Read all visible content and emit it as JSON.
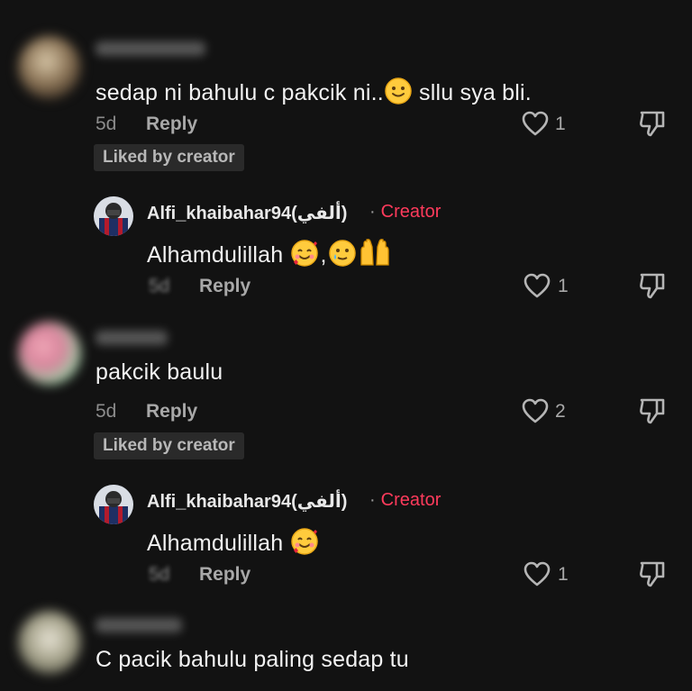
{
  "comments": [
    {
      "text": "sedap ni bahulu c pakcik ni..",
      "text_after_emoji": " sllu sya bli.",
      "age": "5d",
      "reply_label": "Reply",
      "likes": "1",
      "badge": "Liked by creator"
    },
    {
      "username": "Alfi_khaibahar94(ألفي)",
      "separator": "·",
      "creator_label": "Creator",
      "text": "Alhamdulillah",
      "text_between": ",",
      "age": "5d",
      "reply_label": "Reply",
      "likes": "1"
    },
    {
      "text": "pakcik baulu",
      "age": "5d",
      "reply_label": "Reply",
      "likes": "2",
      "badge": "Liked by creator"
    },
    {
      "username": "Alfi_khaibahar94(ألفي)",
      "separator": "·",
      "creator_label": "Creator",
      "text": "Alhamdulillah",
      "age": "5d",
      "reply_label": "Reply",
      "likes": "1"
    },
    {
      "text": "C pacik bahulu paling sedap tu"
    }
  ],
  "icons": {
    "like": "heart-outline-icon",
    "dislike": "thumbs-down-icon",
    "emoji_slight_smile": "slightly-smiling-face-icon",
    "emoji_hearts": "smiling-face-with-hearts-icon",
    "emoji_tear": "smiling-face-with-tear-icon",
    "emoji_hands": "raised-hands-icon"
  },
  "colors": {
    "background": "#121212",
    "creator": "#ff3b5c",
    "badge_bg": "#2a2a2a",
    "muted": "#a8a8a8"
  }
}
